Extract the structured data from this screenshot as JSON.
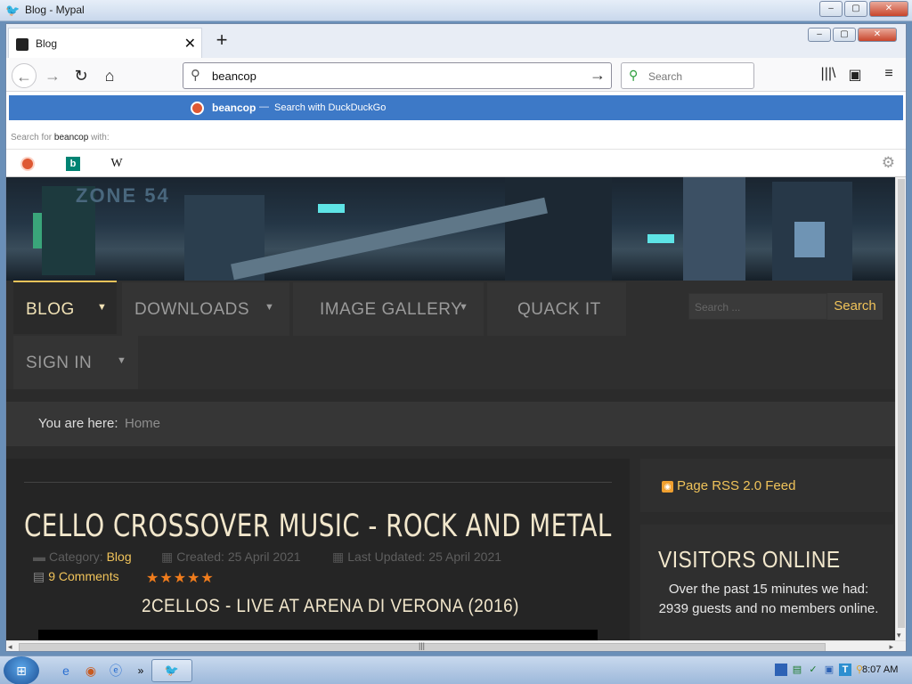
{
  "os_window": {
    "title": "Blog - Mypal",
    "minimize_label": "–",
    "maximize_label": "▢",
    "close_label": "✕"
  },
  "tabs": [
    {
      "label": "Blog",
      "close_label": "✕"
    }
  ],
  "newtab_label": "+",
  "nav": {
    "back_icon": "←",
    "forward_icon": "→",
    "reload_icon": "↻",
    "home_icon": "⌂",
    "url_value": "beancop",
    "go_icon": "→",
    "search_placeholder": "Search",
    "library_icon": "|||\\",
    "sidebar_icon": "▣",
    "menu_icon": "≡"
  },
  "autocomplete": {
    "suggestion_term": "beancop",
    "suggestion_sep": "—",
    "suggestion_action": "Search with DuckDuckGo",
    "search_for_prefix": "Search for",
    "search_for_term": "beancop",
    "search_for_suffix": "with:",
    "engines": [
      "duckduckgo-icon",
      "bing-icon",
      "wikipedia-icon"
    ],
    "bing_glyph": "b",
    "wiki_glyph": "W",
    "settings_icon": "⚙"
  },
  "site": {
    "logo_text": "ZONE 54",
    "menu": [
      {
        "label": "BLOG",
        "has_caret": true,
        "active": true
      },
      {
        "label": "DOWNLOADS",
        "has_caret": true,
        "active": false
      },
      {
        "label": "IMAGE GALLERY",
        "has_caret": true,
        "active": false
      },
      {
        "label": "QUACK IT",
        "has_caret": false,
        "active": false
      },
      {
        "label": "SIGN IN",
        "has_caret": true,
        "active": false
      }
    ],
    "caret": "▼",
    "search_placeholder": "Search ...",
    "search_button": "Search",
    "breadcrumb_lead": "You are here:",
    "breadcrumb_home": "Home",
    "article": {
      "title": "CELLO CROSSOVER MUSIC - ROCK AND METAL",
      "category_label": "Category:",
      "category_value": "Blog",
      "created": "Created: 25 April 2021",
      "updated": "Last Updated: 25 April 2021",
      "comments": "9 Comments",
      "stars": "★★★★★",
      "video_title": "2CELLOS - LIVE AT ARENA DI VERONA (2016)"
    },
    "rss_label": "Page RSS 2.0 Feed",
    "visitors_heading": "VISITORS ONLINE",
    "visitors_text": "Over the past 15 minutes we had: 2939 guests and no members online."
  },
  "scroll": {
    "h_grip": "|||",
    "left_arrow": "◂",
    "right_arrow": "▸",
    "down_arrow": "▾"
  },
  "taskbar": {
    "clock": "8:07 AM",
    "chevron": "»"
  },
  "colors": {
    "accent_gold": "#f0c35a",
    "suggestion_blue": "#3d79c7",
    "ddg_orange": "#de5833",
    "star_orange": "#f07c1c"
  }
}
